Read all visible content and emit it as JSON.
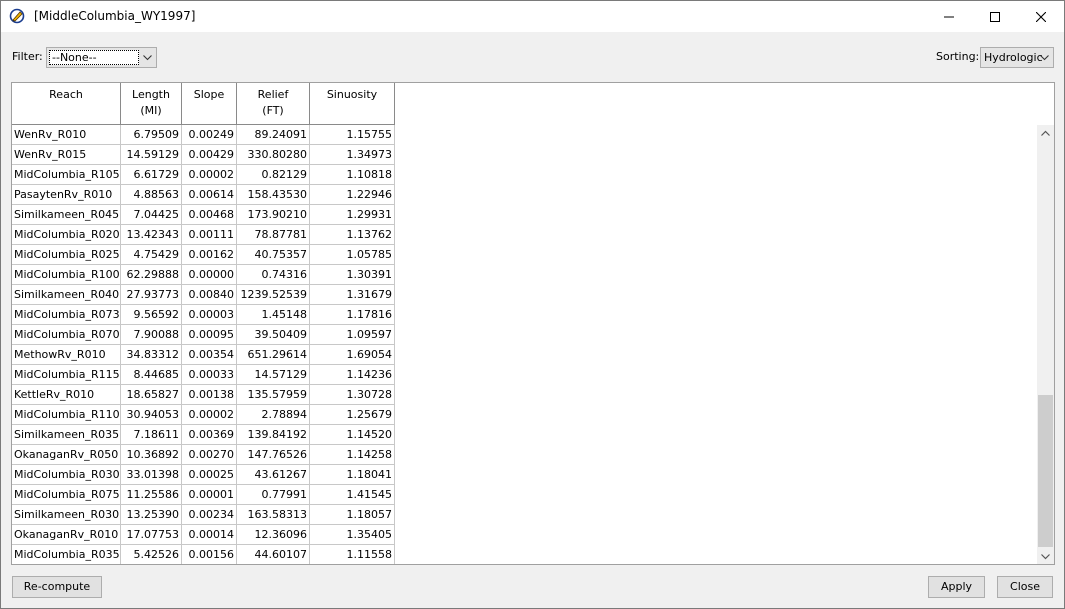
{
  "window": {
    "title": "[MiddleColumbia_WY1997]"
  },
  "toolbar": {
    "filter_label": "Filter:",
    "filter_value": "--None--",
    "sorting_label": "Sorting:",
    "sorting_value": "Hydrologic"
  },
  "table": {
    "headers": [
      {
        "line1": "Reach",
        "line2": ""
      },
      {
        "line1": "Length",
        "line2": "(MI)"
      },
      {
        "line1": "Slope",
        "line2": ""
      },
      {
        "line1": "Relief",
        "line2": "(FT)"
      },
      {
        "line1": "Sinuosity",
        "line2": ""
      }
    ],
    "rows": [
      [
        "WenRv_R010",
        "6.79509",
        "0.00249",
        "89.24091",
        "1.15755"
      ],
      [
        "WenRv_R015",
        "14.59129",
        "0.00429",
        "330.80280",
        "1.34973"
      ],
      [
        "MidColumbia_R105",
        "6.61729",
        "0.00002",
        "0.82129",
        "1.10818"
      ],
      [
        "PasaytenRv_R010",
        "4.88563",
        "0.00614",
        "158.43530",
        "1.22946"
      ],
      [
        "Similkameen_R045",
        "7.04425",
        "0.00468",
        "173.90210",
        "1.29931"
      ],
      [
        "MidColumbia_R020",
        "13.42343",
        "0.00111",
        "78.87781",
        "1.13762"
      ],
      [
        "MidColumbia_R025",
        "4.75429",
        "0.00162",
        "40.75357",
        "1.05785"
      ],
      [
        "MidColumbia_R100",
        "62.29888",
        "0.00000",
        "0.74316",
        "1.30391"
      ],
      [
        "Similkameen_R040",
        "27.93773",
        "0.00840",
        "1239.52539",
        "1.31679"
      ],
      [
        "MidColumbia_R073",
        "9.56592",
        "0.00003",
        "1.45148",
        "1.17816"
      ],
      [
        "MidColumbia_R070",
        "7.90088",
        "0.00095",
        "39.50409",
        "1.09597"
      ],
      [
        "MethowRv_R010",
        "34.83312",
        "0.00354",
        "651.29614",
        "1.69054"
      ],
      [
        "MidColumbia_R115",
        "8.44685",
        "0.00033",
        "14.57129",
        "1.14236"
      ],
      [
        "KettleRv_R010",
        "18.65827",
        "0.00138",
        "135.57959",
        "1.30728"
      ],
      [
        "MidColumbia_R110",
        "30.94053",
        "0.00002",
        "2.78894",
        "1.25679"
      ],
      [
        "Similkameen_R035",
        "7.18611",
        "0.00369",
        "139.84192",
        "1.14520"
      ],
      [
        "OkanaganRv_R050",
        "10.36892",
        "0.00270",
        "147.76526",
        "1.14258"
      ],
      [
        "MidColumbia_R030",
        "33.01398",
        "0.00025",
        "43.61267",
        "1.18041"
      ],
      [
        "MidColumbia_R075",
        "11.25586",
        "0.00001",
        "0.77991",
        "1.41545"
      ],
      [
        "Similkameen_R030",
        "13.25390",
        "0.00234",
        "163.58313",
        "1.18057"
      ],
      [
        "OkanaganRv_R010",
        "17.07753",
        "0.00014",
        "12.36096",
        "1.35405"
      ],
      [
        "MidColumbia_R035",
        "5.42526",
        "0.00156",
        "44.60107",
        "1.11558"
      ]
    ]
  },
  "buttons": {
    "recompute": "Re-compute",
    "apply": "Apply",
    "close": "Close"
  },
  "icons": {
    "app": "pencil-globe-icon",
    "minimize": "minimize-icon",
    "maximize": "maximize-icon",
    "close": "close-icon"
  }
}
